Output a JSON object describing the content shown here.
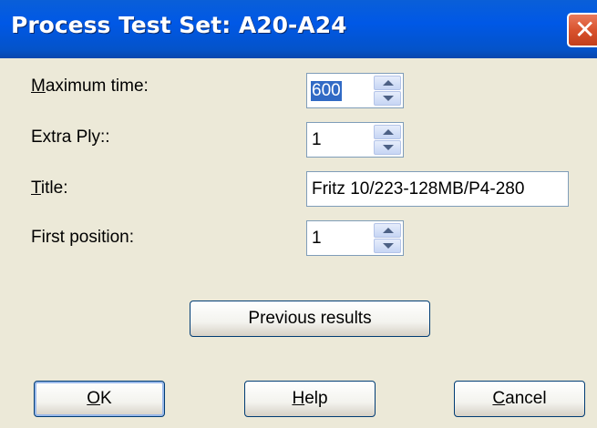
{
  "dialog": {
    "title": "Process Test Set: A20-A24",
    "close_icon": "close-icon"
  },
  "fields": {
    "max_time": {
      "label_accel": "M",
      "label_rest": "aximum time:",
      "value": "600"
    },
    "extra_ply": {
      "label": "Extra Ply::",
      "value": "1"
    },
    "title": {
      "label_accel": "T",
      "label_rest": "itle:",
      "value": "Fritz 10/223-128MB/P4-280"
    },
    "first_position": {
      "label": "First position:",
      "value": "1"
    }
  },
  "buttons": {
    "previous_results": "Previous results",
    "ok_accel": "O",
    "ok_rest": "K",
    "help_accel": "H",
    "help_rest": "elp",
    "cancel_accel": "C",
    "cancel_rest": "ancel"
  },
  "colors": {
    "titlebar": "#0058e6",
    "dialog_bg": "#ece9d8",
    "selection": "#316ac5",
    "close_button": "#d9532e"
  }
}
